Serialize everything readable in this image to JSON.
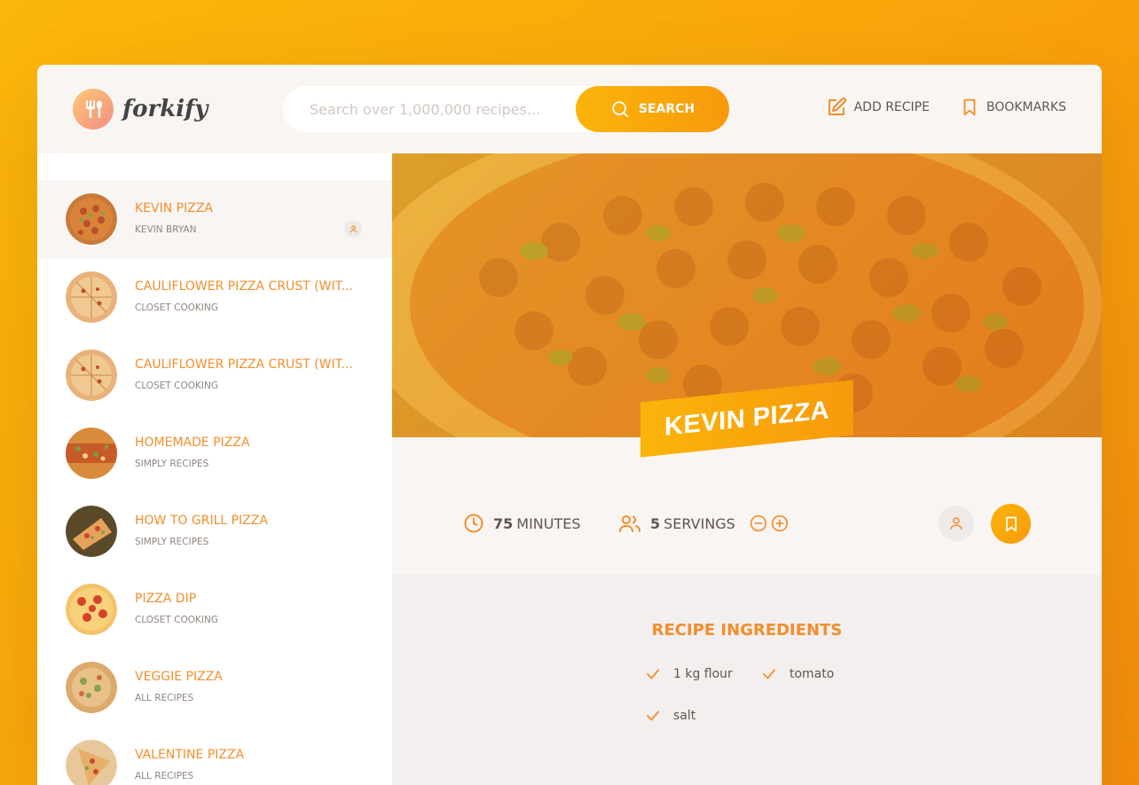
{
  "header": {
    "logo_text": "forkify",
    "search_placeholder": "Search over 1,000,000 recipes...",
    "search_label": "Search",
    "add_recipe_label": "Add recipe",
    "bookmarks_label": "Bookmarks"
  },
  "results": [
    {
      "title": "Kevin Pizza",
      "publisher": "Kevin Bryan",
      "active": true,
      "user_generated": true
    },
    {
      "title": "Cauliflower Pizza Crust (wit...",
      "publisher": "Closet Cooking"
    },
    {
      "title": "Cauliflower Pizza Crust (wit...",
      "publisher": "Closet Cooking"
    },
    {
      "title": "Homemade Pizza",
      "publisher": "Simply Recipes"
    },
    {
      "title": "How to Grill Pizza",
      "publisher": "Simply Recipes"
    },
    {
      "title": "Pizza Dip",
      "publisher": "Closet Cooking"
    },
    {
      "title": "Veggie Pizza",
      "publisher": "All Recipes"
    },
    {
      "title": "Valentine Pizza",
      "publisher": "All Recipes"
    }
  ],
  "recipe": {
    "title": "Kevin Pizza",
    "minutes": "75",
    "minutes_label": "minutes",
    "servings": "5",
    "servings_label": "servings",
    "ingredients_heading": "Recipe ingredients",
    "ingredients": [
      "1 kg flour",
      "tomato",
      "salt"
    ]
  },
  "colors": {
    "accent": "#f38e2b",
    "gradient_start": "#fbb40a",
    "gradient_end": "#f79a0c",
    "bg_light": "#f9f5f3"
  }
}
